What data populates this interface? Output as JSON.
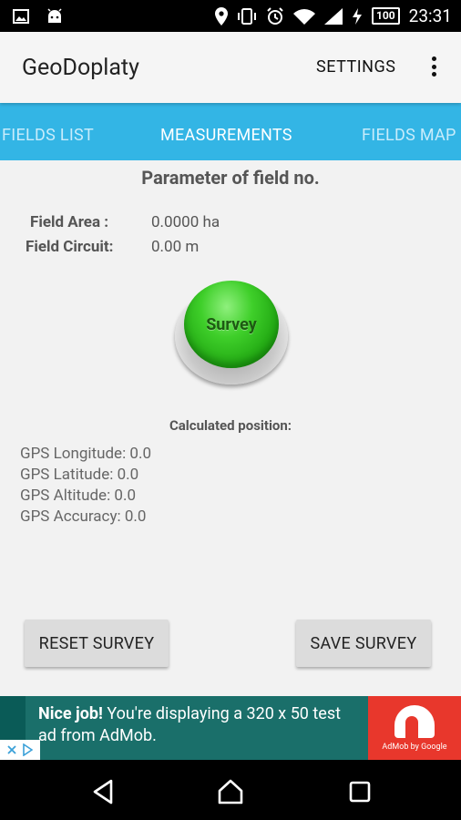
{
  "status_bar": {
    "left_icons": [
      "image-icon",
      "android-icon"
    ],
    "right_icons": [
      "location-icon",
      "vibrate-icon",
      "alarm-icon",
      "wifi-icon",
      "signal-icon",
      "charging-icon"
    ],
    "battery": "100",
    "time": "23:31"
  },
  "app_bar": {
    "title": "GeoDoplaty",
    "settings_label": "SETTINGS",
    "overflow_icon": "more-vert-icon"
  },
  "tabs": [
    {
      "label": "FIELDS LIST",
      "active": false
    },
    {
      "label": "MEASUREMENTS",
      "active": true
    },
    {
      "label": "FIELDS MAP",
      "active": false
    }
  ],
  "measurements": {
    "title": "Parameter of field no.",
    "area_label": "Field Area :",
    "area_value": "0.0000 ha",
    "circuit_label": "Field Circuit:",
    "circuit_value": "0.00 m",
    "survey_button": "Survey",
    "calc_title": "Calculated position:",
    "gps": [
      "GPS Longitude: 0.0",
      "GPS Latitude: 0.0",
      "GPS Altitude: 0.0",
      "GPS Accuracy: 0.0"
    ],
    "reset_button": "RESET SURVEY",
    "save_button": "SAVE SURVEY"
  },
  "ad": {
    "headline": "Nice job!",
    "body": " You're displaying a 320 x 50 test ad from AdMob.",
    "logo_text": "AdMob by Google",
    "choices_icon": "ad-choices-icon"
  },
  "nav_bar": {
    "icons": [
      "back-icon",
      "home-icon",
      "recents-icon"
    ]
  },
  "colors": {
    "tab_bar": "#33b5e5",
    "survey_green": "#22a913",
    "ad_background": "#1a6f6a",
    "ad_logo": "#e8372c"
  }
}
